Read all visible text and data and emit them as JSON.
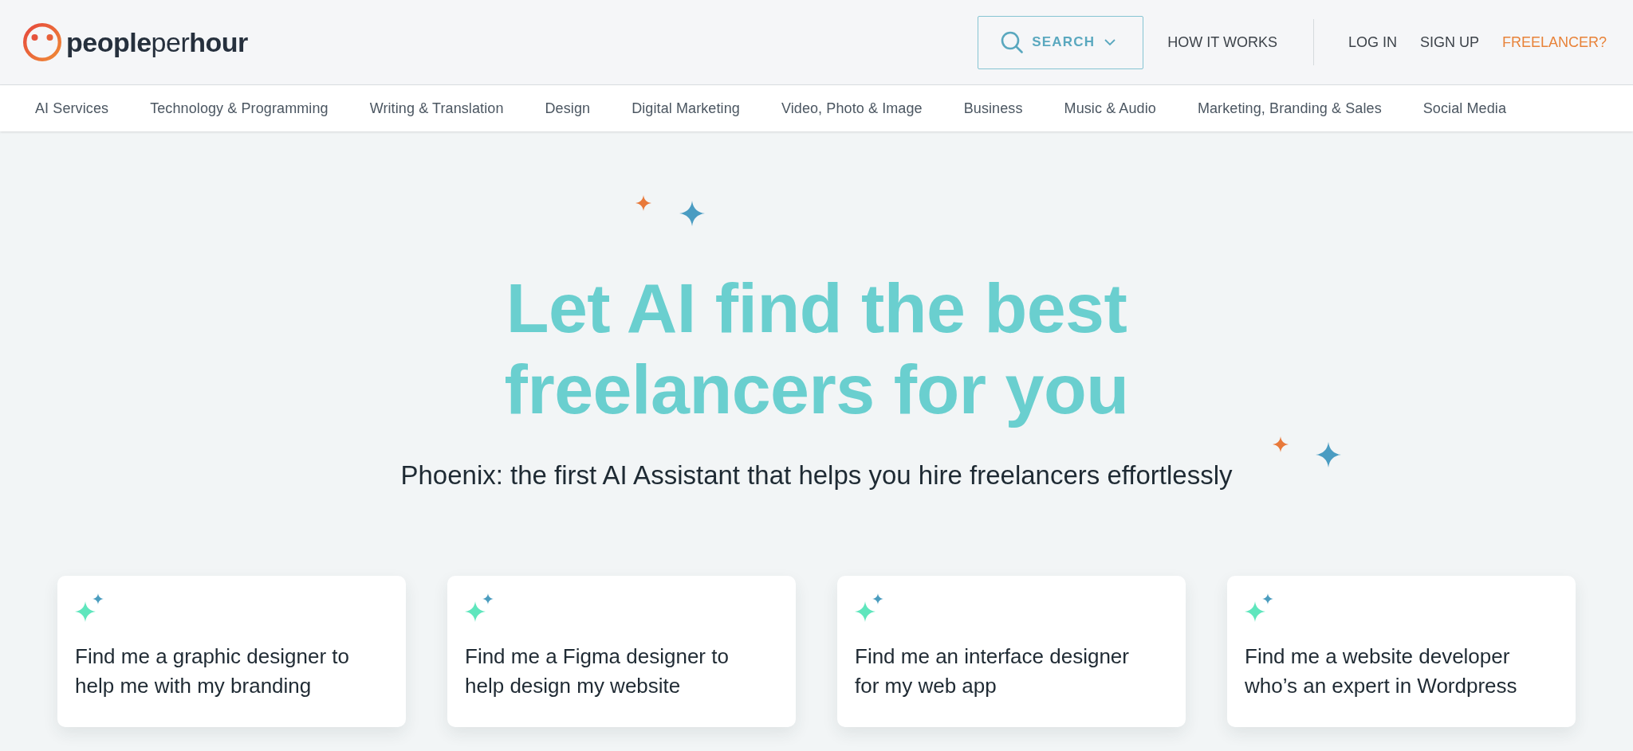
{
  "header": {
    "logo": "**people**per**hour**",
    "search": {
      "label": "SEARCH"
    },
    "links": [
      {
        "label": "HOW IT WORKS",
        "kind": "link"
      }
    ],
    "account_links": [
      {
        "label": "LOG IN",
        "kind": "link"
      },
      {
        "label": "SIGN UP",
        "kind": "link"
      },
      {
        "label": "FREELANCER?",
        "kind": "accent"
      }
    ]
  },
  "categories": [
    "AI Services",
    "Technology & Programming",
    "Writing & Translation",
    "Design",
    "Digital Marketing",
    "Video, Photo & Image",
    "Business",
    "Music & Audio",
    "Marketing, Branding & Sales",
    "Social Media"
  ],
  "hero": {
    "title": "Let AI find the best freelancers for you",
    "subtitle": "Phoenix: the first AI Assistant that helps you hire freelancers effortlessly"
  },
  "prompts": [
    {
      "text": "Find me a graphic designer to help me with my branding"
    },
    {
      "text": "Find me a Figma designer to help design my website"
    },
    {
      "text": "Find me an interface designer for my web app"
    },
    {
      "text": "Find me a website developer who’s an expert in Wordpress"
    }
  ]
}
